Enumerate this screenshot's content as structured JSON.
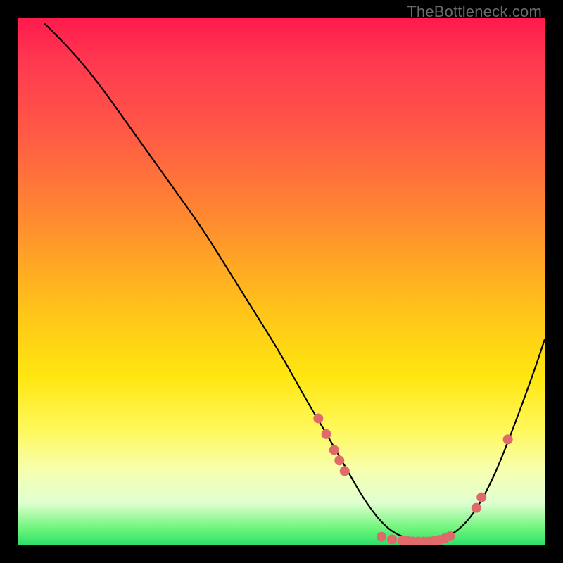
{
  "watermark": "TheBottleneck.com",
  "colors": {
    "background": "#000000",
    "dot": "#e06a6a",
    "curve": "#000000"
  },
  "chart_data": {
    "type": "line",
    "title": "",
    "xlabel": "",
    "ylabel": "",
    "xlim": [
      0,
      100
    ],
    "ylim": [
      0,
      100
    ],
    "curve": {
      "x": [
        5,
        10,
        15,
        20,
        25,
        30,
        35,
        40,
        45,
        50,
        55,
        58,
        62,
        66,
        70,
        74,
        78,
        82,
        86,
        90,
        94,
        98,
        100
      ],
      "y": [
        99,
        94,
        88,
        81,
        74,
        67,
        60,
        52,
        44,
        36,
        27,
        22,
        15,
        8,
        3,
        1,
        0.5,
        1.5,
        5,
        12,
        22,
        33,
        39
      ]
    },
    "series": [
      {
        "name": "markers",
        "points": [
          {
            "x": 57,
            "y": 24
          },
          {
            "x": 58.5,
            "y": 21
          },
          {
            "x": 60,
            "y": 18
          },
          {
            "x": 61,
            "y": 16
          },
          {
            "x": 62,
            "y": 14
          },
          {
            "x": 69,
            "y": 1.5
          },
          {
            "x": 71,
            "y": 1
          },
          {
            "x": 73,
            "y": 0.8
          },
          {
            "x": 74,
            "y": 0.7
          },
          {
            "x": 75,
            "y": 0.6
          },
          {
            "x": 76,
            "y": 0.6
          },
          {
            "x": 77,
            "y": 0.6
          },
          {
            "x": 78,
            "y": 0.6
          },
          {
            "x": 79,
            "y": 0.7
          },
          {
            "x": 80,
            "y": 0.9
          },
          {
            "x": 81,
            "y": 1.2
          },
          {
            "x": 82,
            "y": 1.6
          },
          {
            "x": 87,
            "y": 7
          },
          {
            "x": 88,
            "y": 9
          },
          {
            "x": 93,
            "y": 20
          }
        ]
      }
    ]
  }
}
